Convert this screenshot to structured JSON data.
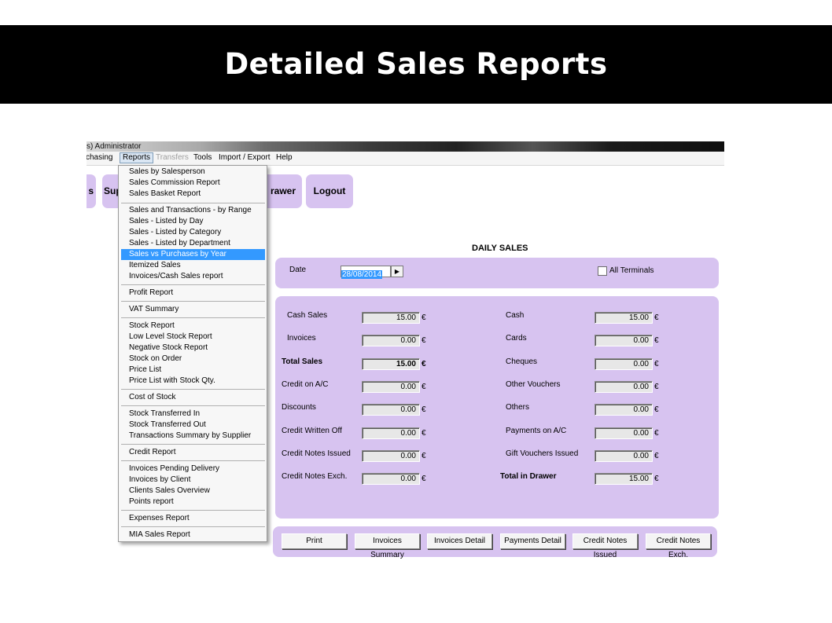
{
  "slide": {
    "title": "Detailed Sales Reports"
  },
  "window": {
    "title": "s) Administrator"
  },
  "menubar": {
    "items": [
      {
        "label": "chasing"
      },
      {
        "label": "Reports"
      },
      {
        "label": "Transfers"
      },
      {
        "label": "Tools"
      },
      {
        "label": "Import / Export"
      },
      {
        "label": "Help"
      }
    ]
  },
  "toolbar": {
    "btn_s": "s",
    "btn_sup": "Sup",
    "btn_drawer": "rawer",
    "logout": "Logout"
  },
  "reports_menu": {
    "items": [
      "Sales  by Salesperson",
      "Sales Commission Report",
      "Sales Basket Report",
      "Sales and Transactions - by Range",
      "Sales - Listed by Day",
      "Sales - Listed by Category",
      "Sales - Listed by Department",
      "Sales vs Purchases by Year",
      "Itemized Sales",
      "Invoices/Cash Sales report",
      "Profit  Report",
      "VAT Summary",
      "Stock Report",
      "Low Level Stock Report",
      "Negative Stock Report",
      "Stock on Order",
      "Price List",
      "Price List with Stock Qty.",
      "Cost of Stock",
      "Stock Transferred In",
      "Stock Transferred Out",
      "Transactions Summary by Supplier",
      "Credit Report",
      "Invoices Pending Delivery",
      "Invoices by Client",
      "Clients Sales Overview",
      "Points report",
      "Expenses Report",
      "MIA Sales Report"
    ]
  },
  "daily_sales": {
    "title": "DAILY SALES",
    "date_label": "Date",
    "date_value": "28/08/2014",
    "all_terminals": "All Terminals",
    "currency": "€",
    "left": [
      {
        "label": "Cash Sales",
        "value": "15.00"
      },
      {
        "label": "Invoices",
        "value": "0.00"
      },
      {
        "label": "Total Sales",
        "value": "15.00"
      },
      {
        "label": "Credit on A/C",
        "value": "0.00"
      },
      {
        "label": "Discounts",
        "value": "0.00"
      },
      {
        "label": "Credit Written Off",
        "value": "0.00"
      },
      {
        "label": "Credit Notes Issued",
        "value": "0.00"
      },
      {
        "label": "Credit Notes Exch.",
        "value": "0.00"
      }
    ],
    "right": [
      {
        "label": "Cash",
        "value": "15.00"
      },
      {
        "label": "Cards",
        "value": "0.00"
      },
      {
        "label": "Cheques",
        "value": "0.00"
      },
      {
        "label": "Other Vouchers",
        "value": "0.00"
      },
      {
        "label": "Others",
        "value": "0.00"
      },
      {
        "label": "Payments on A/C",
        "value": "0.00"
      },
      {
        "label": "Gift Vouchers Issued",
        "value": "0.00"
      },
      {
        "label": "Total in Drawer",
        "value": "15.00"
      }
    ]
  },
  "buttons": {
    "print": "Print",
    "invoices_summary": "Invoices Summary",
    "invoices_detail": "Invoices Detail",
    "payments_detail": "Payments Detail",
    "credit_notes_issued": "Credit Notes Issued",
    "credit_notes_exch": "Credit Notes Exch."
  }
}
